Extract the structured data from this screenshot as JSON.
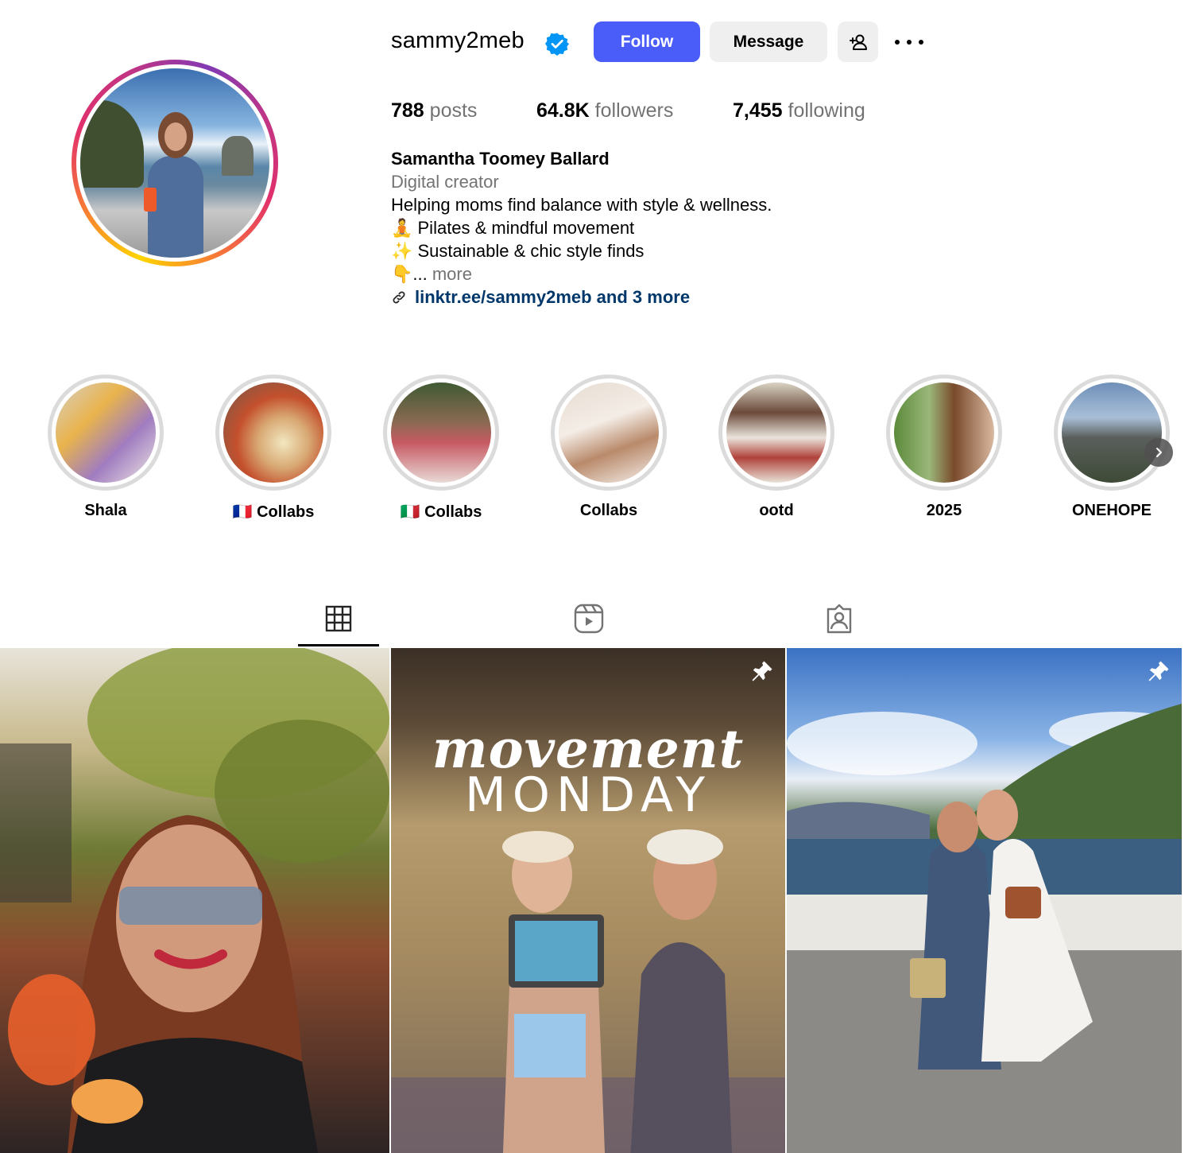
{
  "profile": {
    "username": "sammy2meb",
    "follow_label": "Follow",
    "message_label": "Message",
    "stats": {
      "posts_count": "788",
      "posts_label": "posts",
      "followers_count": "64.8K",
      "followers_label": "followers",
      "following_count": "7,455",
      "following_label": "following"
    },
    "bio": {
      "name": "Samantha Toomey Ballard",
      "category": "Digital creator",
      "line1": "Helping moms find balance with style & wellness.",
      "line2": "🧘 Pilates & mindful movement",
      "line3": "✨ Sustainable & chic style finds",
      "line4_emoji": "👇...",
      "more": "more",
      "link": "linktr.ee/sammy2meb and 3 more"
    }
  },
  "highlights": [
    {
      "label": "Shala"
    },
    {
      "label": "🇫🇷 Collabs"
    },
    {
      "label": "🇮🇹 Collabs"
    },
    {
      "label": "Collabs"
    },
    {
      "label": "ootd"
    },
    {
      "label": "2025"
    },
    {
      "label": "ONEHOPE"
    }
  ],
  "posts": {
    "post2_title_line1": "movement",
    "post2_title_line2": "MONDAY"
  },
  "colors": {
    "follow_button": "#4a5df9",
    "link": "#00376b",
    "verified": "#0095f6"
  }
}
